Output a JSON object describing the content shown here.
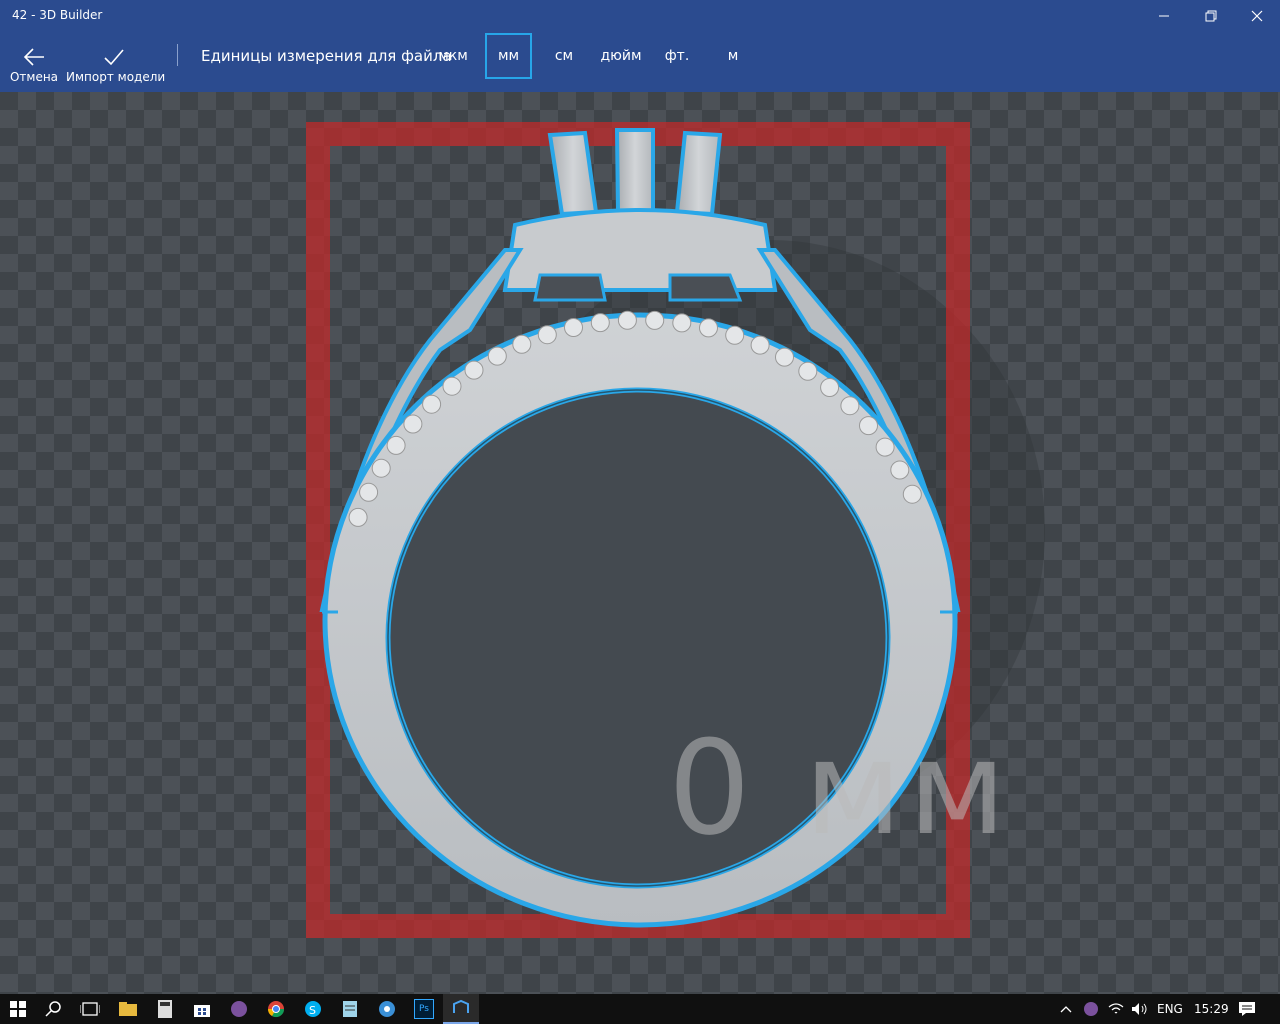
{
  "window": {
    "title": "42 - 3D Builder",
    "minimize_icon": "minimize-icon",
    "restore_icon": "restore-icon",
    "close_icon": "close-icon"
  },
  "commandbar": {
    "cancel_label": "Отмена",
    "import_label": "Импорт модели",
    "units_label": "Единицы измерения для файла",
    "units": [
      "мкм",
      "мм",
      "см",
      "дюйм",
      "фт.",
      "м"
    ],
    "selected_unit": "мм",
    "accent": "#27a6e9"
  },
  "viewport": {
    "dimension_text": "0 мм",
    "model": "ring",
    "bounding_box_color": "#c02a2a",
    "outline_color": "#2aa7e8"
  },
  "taskbar": {
    "apps": [
      "start-icon",
      "search-icon",
      "task-view-icon",
      "file-explorer-icon",
      "calculator-icon",
      "store-icon",
      "viber-icon",
      "chrome-icon",
      "skype-icon",
      "notepad-icon",
      "browser-icon",
      "photoshop-icon",
      "3d-builder-icon"
    ],
    "tray_language": "ENG",
    "clock": "15:29",
    "photoshop_label": "Ps"
  }
}
